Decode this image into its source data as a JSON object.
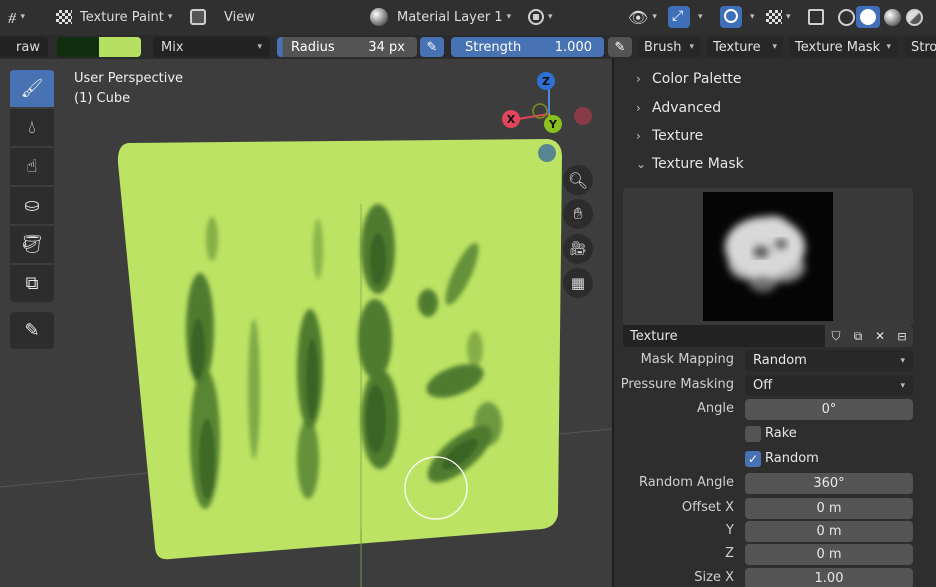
{
  "header": {
    "mode_label": "Texture Paint",
    "view_menu": "View",
    "material_layer": "Material Layer 1"
  },
  "toolrow": {
    "brush_name_partial": "raw",
    "color_primary": "#b5e061",
    "color_secondary": "#0e2e0e",
    "blend_mode": "Mix",
    "radius_label": "Radius",
    "radius_value": "34 px",
    "strength_label": "Strength",
    "strength_value": "1.000",
    "menus": [
      "Brush",
      "Texture",
      "Texture Mask",
      "Stro"
    ]
  },
  "viewport": {
    "perspective_label": "User Perspective",
    "object_label": "(1) Cube",
    "gizmo": {
      "z": "Z",
      "x": "X",
      "y": "Y"
    },
    "plane_color": "#bce364",
    "stroke_color": "#3c6a26"
  },
  "toolbar": {
    "tools": [
      "brush-icon",
      "blur-drop-icon",
      "smear-icon",
      "clone-stamp-icon",
      "fill-bucket-icon",
      "mask-icon",
      "annotate-icon"
    ]
  },
  "panel": {
    "sections": [
      "Color Palette",
      "Advanced",
      "Texture",
      "Texture Mask"
    ],
    "texture_field": "Texture",
    "mask_mapping_label": "Mask Mapping",
    "mask_mapping_value": "Random",
    "pressure_masking_label": "Pressure Masking",
    "pressure_masking_value": "Off",
    "angle_label": "Angle",
    "angle_value": "0°",
    "rake_label": "Rake",
    "random_label": "Random",
    "random_angle_label": "Random Angle",
    "random_angle_value": "360°",
    "offset_x_label": "Offset X",
    "offset_x_value": "0 m",
    "offset_y_label": "Y",
    "offset_y_value": "0 m",
    "offset_z_label": "Z",
    "offset_z_value": "0 m",
    "size_x_label": "Size X",
    "size_x_value": "1.00"
  }
}
